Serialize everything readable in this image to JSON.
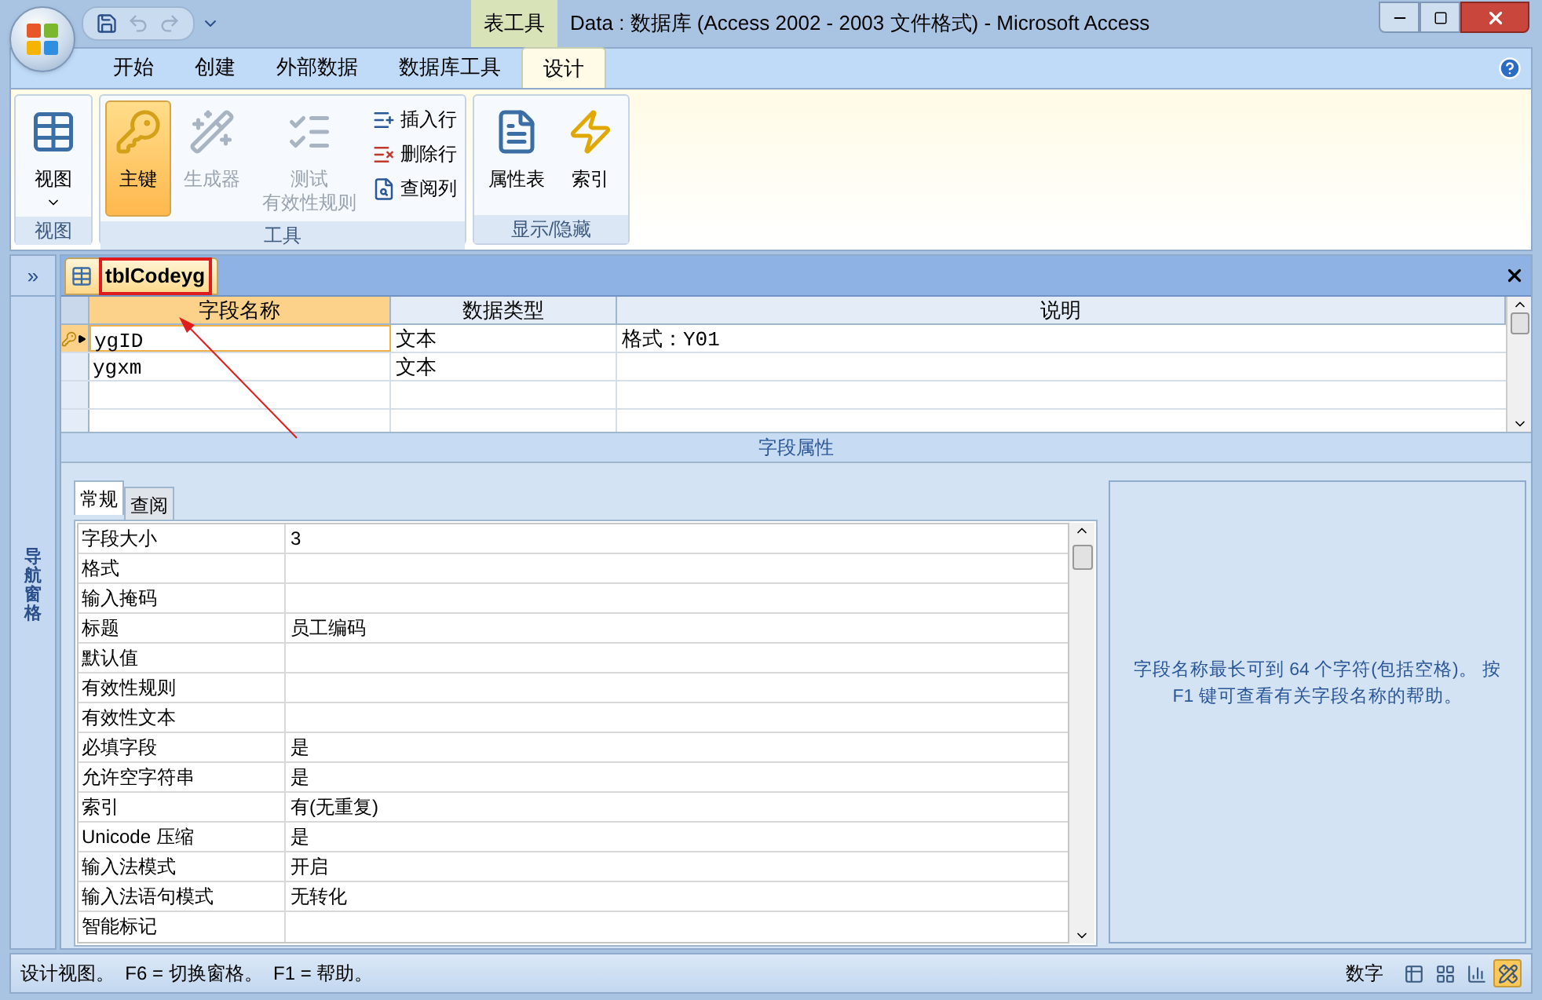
{
  "window": {
    "title": "Data : 数据库 (Access 2002 - 2003 文件格式) - Microsoft Access",
    "context_tab_group": "表工具"
  },
  "ribbon_tabs": [
    {
      "label": "开始",
      "selected": false
    },
    {
      "label": "创建",
      "selected": false
    },
    {
      "label": "外部数据",
      "selected": false
    },
    {
      "label": "数据库工具",
      "selected": false
    },
    {
      "label": "设计",
      "selected": true
    }
  ],
  "ribbon_groups": [
    {
      "label": "视图",
      "buttons": [
        {
          "kind": "large",
          "label": "视图",
          "dropdown": true,
          "selected": false,
          "disabled": false
        }
      ]
    },
    {
      "label": "工具",
      "buttons": [
        {
          "kind": "large",
          "label": "主键",
          "selected": true,
          "disabled": false
        },
        {
          "kind": "large",
          "label": "生成器",
          "selected": false,
          "disabled": true
        },
        {
          "kind": "large",
          "label": "测试",
          "label_2": "有效性规则",
          "selected": false,
          "disabled": true
        },
        {
          "kind": "small",
          "label": "插入行",
          "selected": false,
          "disabled": false
        },
        {
          "kind": "small",
          "label": "删除行",
          "selected": false,
          "disabled": false
        },
        {
          "kind": "small",
          "label": "查阅列",
          "selected": false,
          "disabled": false
        }
      ]
    },
    {
      "label": "显示/隐藏",
      "buttons": [
        {
          "kind": "large",
          "label": "属性表",
          "selected": false,
          "disabled": false
        },
        {
          "kind": "large",
          "label": "索引",
          "selected": false,
          "disabled": false
        }
      ]
    }
  ],
  "nav_pane": {
    "toggle": "»",
    "label": "导航窗格"
  },
  "document": {
    "tab": "tblCodeyg",
    "columns": [
      "字段名称",
      "数据类型",
      "说明"
    ],
    "rows": [
      {
        "field_name": "ygID",
        "data_type": "文本",
        "description": "格式：Y01",
        "primary_key": true,
        "selected": true
      },
      {
        "field_name": "ygxm",
        "data_type": "文本",
        "primary_key": false,
        "selected": false
      }
    ],
    "section_label": "字段属性",
    "property_tabs": [
      {
        "label": "常规",
        "selected": true
      },
      {
        "label": "查阅",
        "selected": false
      }
    ],
    "properties": [
      {
        "name": "字段大小",
        "value": "3"
      },
      {
        "name": "格式"
      },
      {
        "name": "输入掩码"
      },
      {
        "name": "标题",
        "value": "员工编码"
      },
      {
        "name": "默认值"
      },
      {
        "name": "有效性规则"
      },
      {
        "name": "有效性文本"
      },
      {
        "name": "必填字段",
        "value": "是"
      },
      {
        "name": "允许空字符串",
        "value": "是"
      },
      {
        "name": "索引",
        "value": "有(无重复)"
      },
      {
        "name": "Unicode 压缩",
        "value": "是"
      },
      {
        "name": "输入法模式",
        "value": "开启"
      },
      {
        "name": "输入法语句模式",
        "value": "无转化"
      },
      {
        "name": "智能标记"
      }
    ],
    "help_text": "字段名称最长可到 64 个字符(包括空格)。 按 F1 键可查看有关字段名称的帮助。"
  },
  "status_bar": {
    "text": "设计视图。  F6 = 切换窗格。  F1 = 帮助。",
    "indicator": "数字",
    "views": [
      {
        "selected": false
      },
      {
        "selected": false
      },
      {
        "selected": false
      },
      {
        "selected": true
      }
    ]
  }
}
